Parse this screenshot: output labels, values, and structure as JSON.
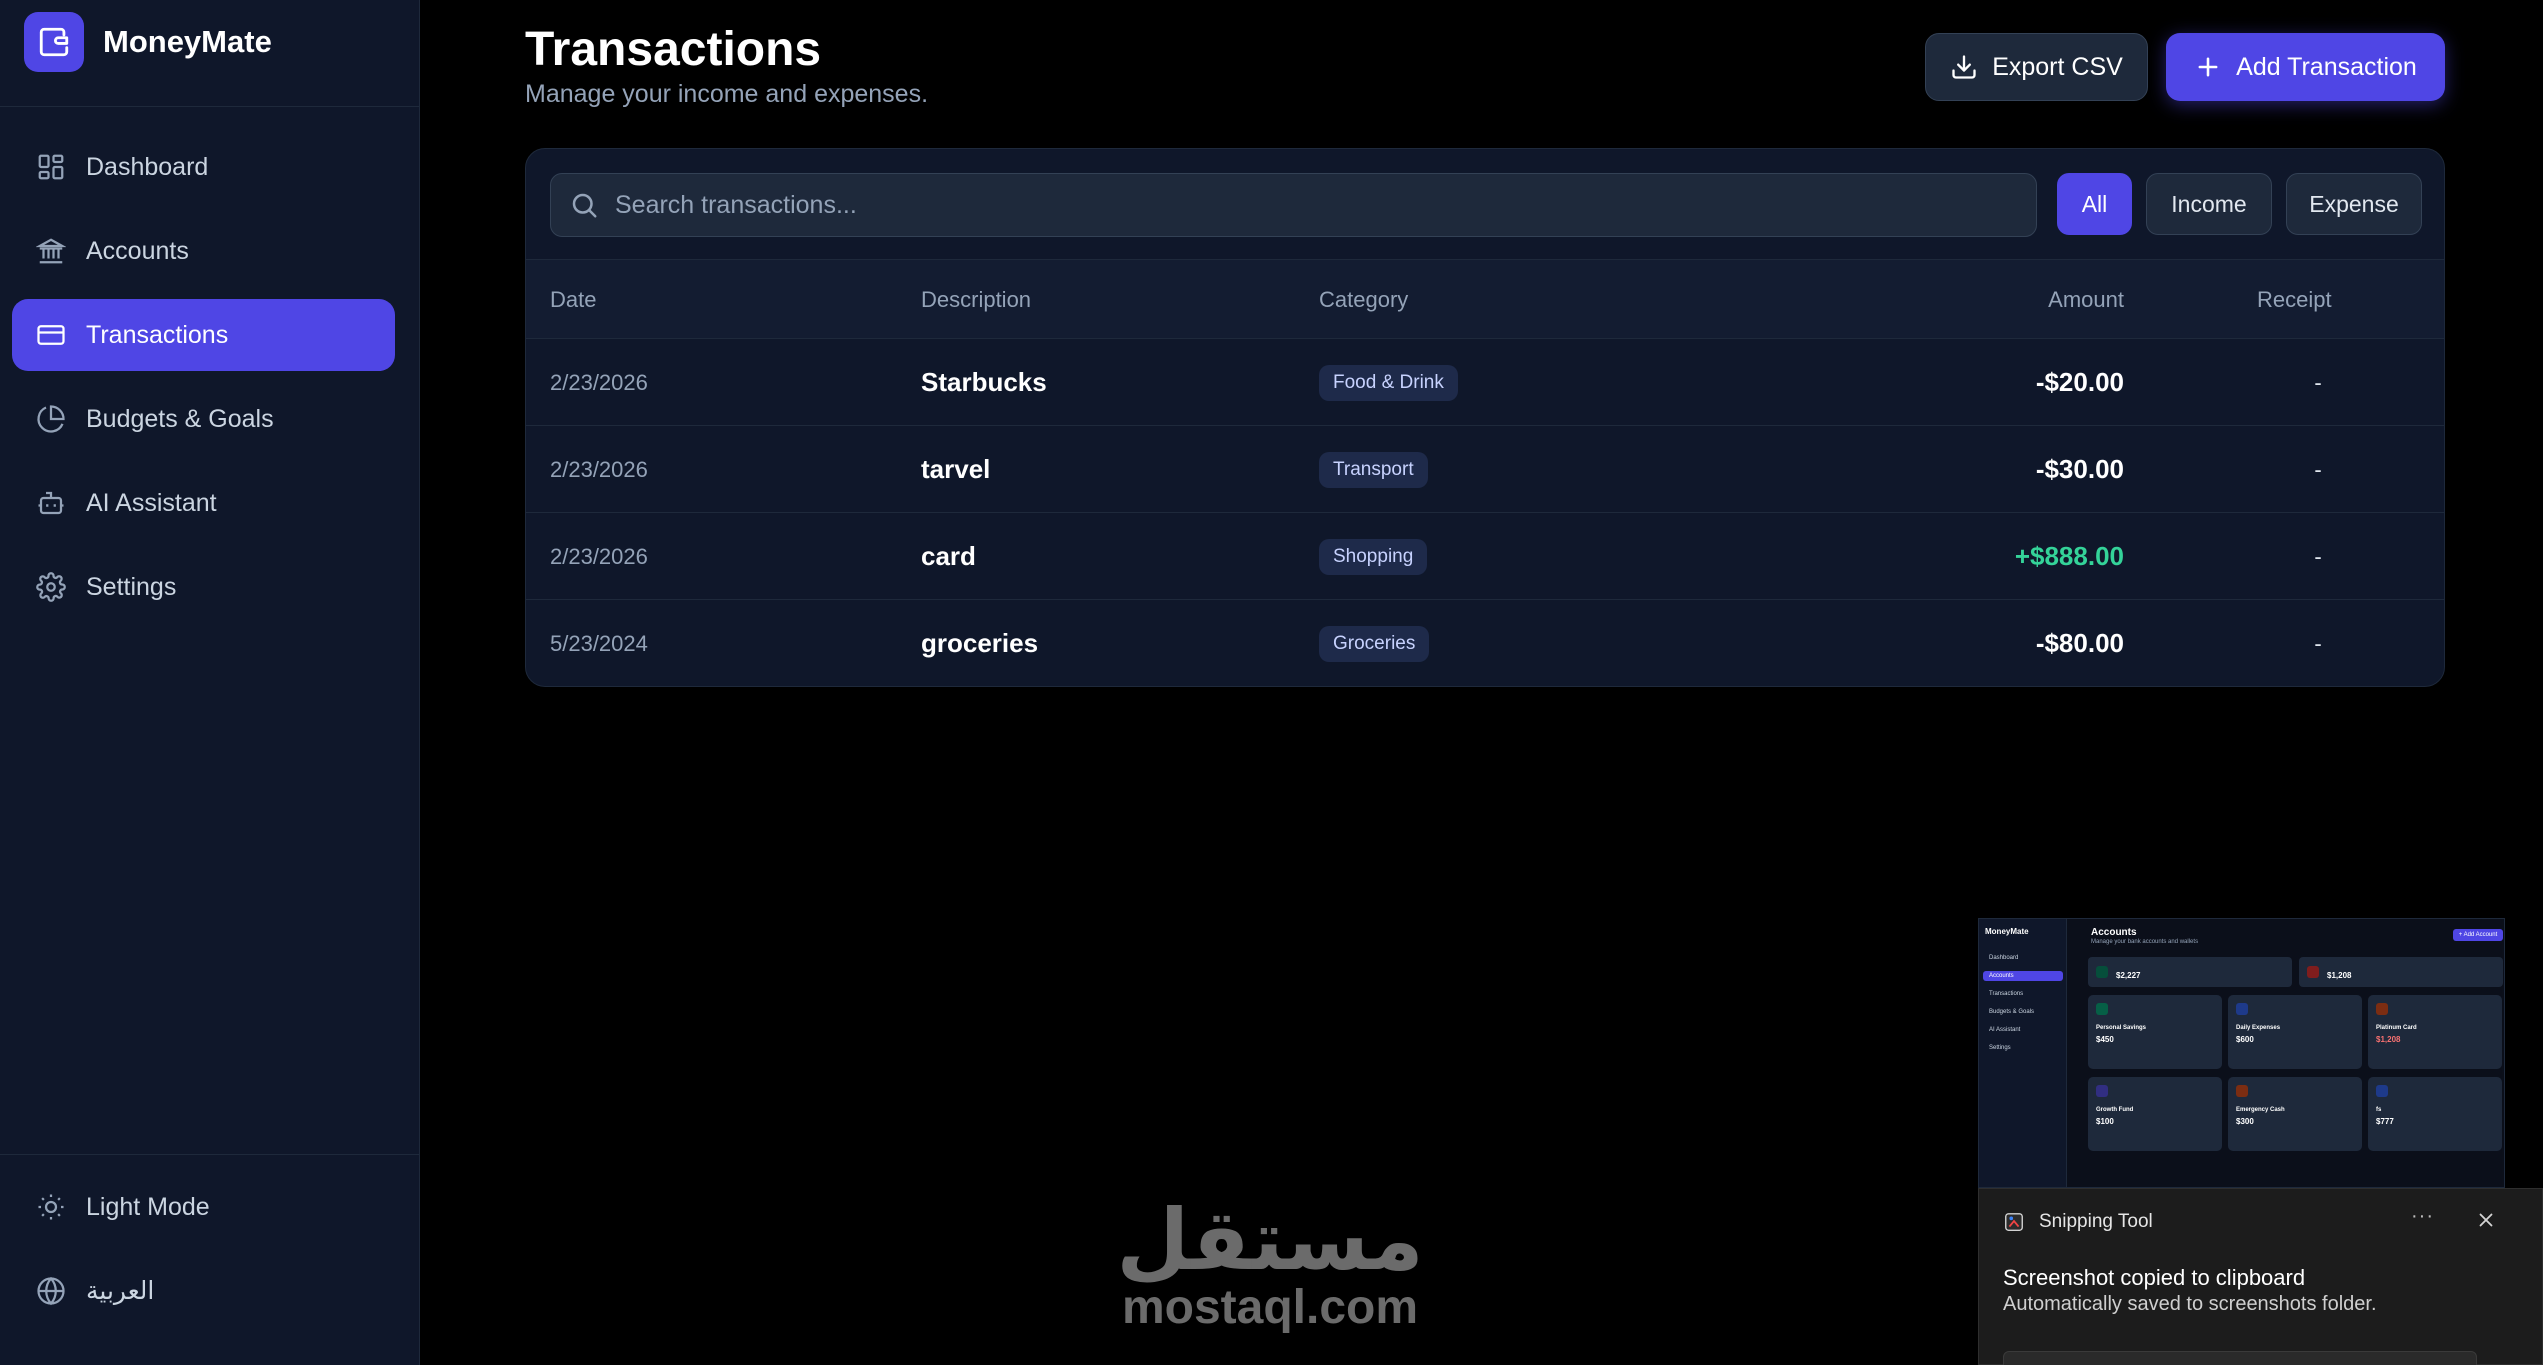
{
  "app": {
    "name": "MoneyMate",
    "logo_icon": "wallet-icon",
    "accent": "#4f46e5"
  },
  "sidebar": {
    "items": [
      {
        "label": "Dashboard",
        "icon": "dashboard-icon",
        "active": false
      },
      {
        "label": "Accounts",
        "icon": "bank-icon",
        "active": false
      },
      {
        "label": "Transactions",
        "icon": "card-icon",
        "active": true
      },
      {
        "label": "Budgets & Goals",
        "icon": "pie-chart-icon",
        "active": false
      },
      {
        "label": "AI Assistant",
        "icon": "bot-icon",
        "active": false
      },
      {
        "label": "Settings",
        "icon": "gear-icon",
        "active": false
      }
    ],
    "bottom": {
      "theme_label": "Light Mode",
      "language_label": "العربية"
    }
  },
  "header": {
    "title": "Transactions",
    "subtitle": "Manage your income and expenses.",
    "export_label": "Export CSV",
    "add_label": "Add Transaction"
  },
  "search": {
    "placeholder": "Search transactions...",
    "value": ""
  },
  "filters": [
    {
      "label": "All",
      "active": true
    },
    {
      "label": "Income",
      "active": false
    },
    {
      "label": "Expense",
      "active": false
    }
  ],
  "table": {
    "columns": [
      "Date",
      "Description",
      "Category",
      "Amount",
      "Receipt"
    ],
    "rows": [
      {
        "date": "2/23/2026",
        "description": "Starbucks",
        "category": "Food & Drink",
        "amount": "-$20.00",
        "type": "expense",
        "receipt": "-"
      },
      {
        "date": "2/23/2026",
        "description": "tarvel",
        "category": "Transport",
        "amount": "-$30.00",
        "type": "expense",
        "receipt": "-"
      },
      {
        "date": "2/23/2026",
        "description": "card",
        "category": "Shopping",
        "amount": "+$888.00",
        "type": "income",
        "receipt": "-"
      },
      {
        "date": "5/23/2024",
        "description": "groceries",
        "category": "Groceries",
        "amount": "-$80.00",
        "type": "expense",
        "receipt": "-"
      }
    ]
  },
  "colors": {
    "income": "#34d399",
    "expense": "#ffffff",
    "background": "#000000",
    "sidebar": "#0f172a"
  },
  "watermark": {
    "arabic": "مستقل",
    "latin": "mostaql.com"
  },
  "snip_preview": {
    "brand": "MoneyMate",
    "title": "Accounts",
    "subtitle": "Manage your bank accounts and wallets",
    "button": "+ Add Account",
    "nav": [
      "Dashboard",
      "Accounts",
      "Transactions",
      "Budgets & Goals",
      "AI Assistant",
      "Settings"
    ],
    "stats": [
      {
        "value": "$2,227"
      },
      {
        "value": "$1,208"
      }
    ],
    "tiles": [
      {
        "name": "Personal Savings",
        "value": "$450"
      },
      {
        "name": "Daily Expenses",
        "value": "$600"
      },
      {
        "name": "Platinum Card",
        "value": "$1,208"
      },
      {
        "name": "Growth Fund",
        "value": "$100"
      },
      {
        "name": "Emergency Cash",
        "value": "$300"
      },
      {
        "name": "fs",
        "value": "$777"
      }
    ]
  },
  "toast": {
    "app": "Snipping Tool",
    "title": "Screenshot copied to clipboard",
    "body": "Automatically saved to screenshots folder."
  }
}
